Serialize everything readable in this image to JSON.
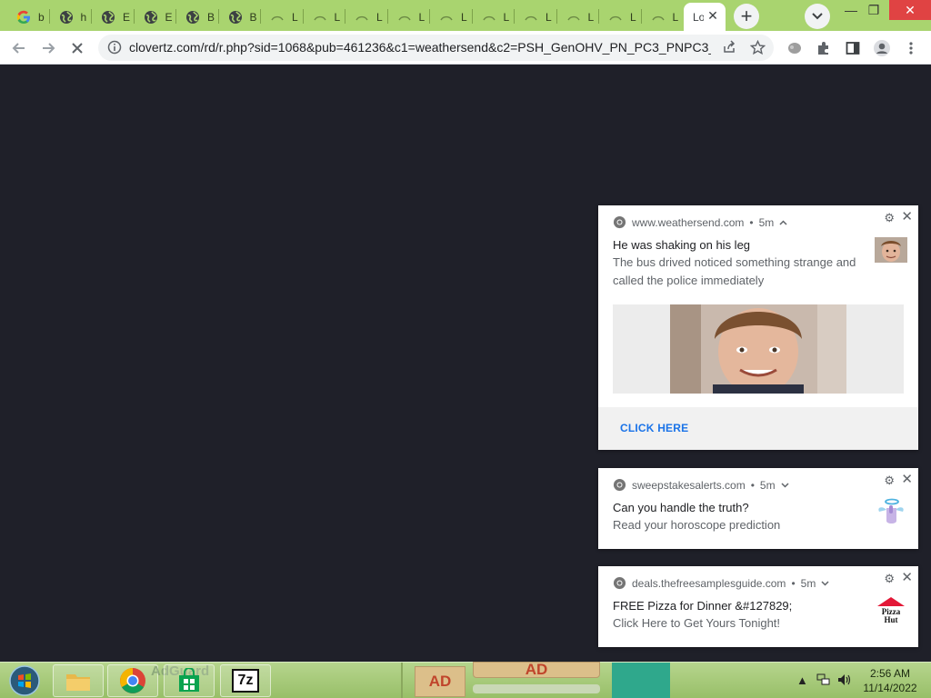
{
  "browser": {
    "tabs": [
      {
        "icon": "google-icon",
        "label": "b"
      },
      {
        "icon": "globe-icon",
        "label": "h"
      },
      {
        "icon": "globe-icon",
        "label": "E"
      },
      {
        "icon": "globe-icon",
        "label": "E"
      },
      {
        "icon": "globe-icon",
        "label": "B"
      },
      {
        "icon": "globe-icon",
        "label": "B"
      },
      {
        "icon": "loading-icon",
        "label": "L"
      },
      {
        "icon": "loading-icon",
        "label": "L"
      },
      {
        "icon": "loading-icon",
        "label": "L"
      },
      {
        "icon": "loading-icon",
        "label": "L"
      },
      {
        "icon": "loading-icon",
        "label": "L"
      },
      {
        "icon": "loading-icon",
        "label": "L"
      },
      {
        "icon": "loading-icon",
        "label": "L"
      },
      {
        "icon": "loading-icon",
        "label": "L"
      },
      {
        "icon": "loading-icon",
        "label": "L"
      },
      {
        "icon": "loading-icon",
        "label": "L"
      }
    ],
    "active_tab_label": "Lo",
    "url": "clovertz.com/rd/r.php?sid=1068&pub=461236&c1=weathersend&c2=PSH_GenOHV_PN_PC3_PNPC3_...",
    "tabstrip_color": "#a9d46f"
  },
  "notifications": [
    {
      "source": "www.weathersend.com",
      "age": "5m",
      "chevron": "chevron-up-icon",
      "title": "He was shaking on his leg",
      "message": "The bus drived noticed something strange and called the police immediately",
      "action": "CLICK HERE"
    },
    {
      "source": "sweepstakesalerts.com",
      "age": "5m",
      "chevron": "chevron-down-icon",
      "title": "Can you handle the truth?",
      "message": "Read your horoscope prediction"
    },
    {
      "source": "deals.thefreesamplesguide.com",
      "age": "5m",
      "chevron": "chevron-down-icon",
      "title": "FREE Pizza for Dinner &#127829;",
      "message": "Click Here to Get Yours Tonight!",
      "logo_text": "Pizza Hut"
    }
  ],
  "taskbar": {
    "adblock_label": "AdGuard",
    "ad_label_1": "AD",
    "ad_label_2": "AD",
    "sevenzip_label": "7z",
    "time": "2:56 AM",
    "date": "11/14/2022"
  }
}
